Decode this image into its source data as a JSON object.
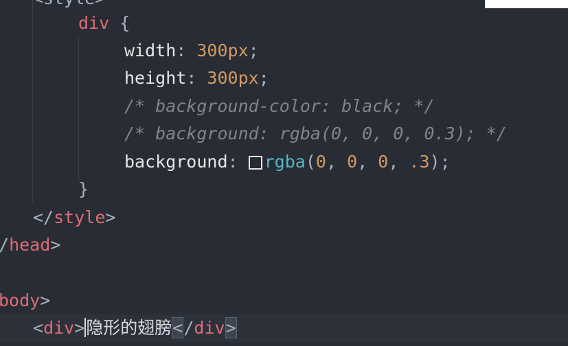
{
  "code": {
    "style_open": "<style>",
    "selector": "div",
    "open_brace": "{",
    "width_prop": "width",
    "width_val": "300px",
    "height_prop": "height",
    "height_val": "300px",
    "comment1": "/* background-color: black; */",
    "comment2": "/* background: rgba(0, 0, 0, 0.3); */",
    "bg_prop": "background",
    "bg_fn": "rgba",
    "bg_r": "0",
    "bg_g": "0",
    "bg_b": "0",
    "bg_a": ".3",
    "close_brace": "}",
    "style_close_tag": "style",
    "head_close_tag": "head",
    "body_tag": "body",
    "div_tag": "div",
    "div_text": "隐形的翅膀"
  },
  "colors": {
    "tag": "#e06c75",
    "number": "#d19a66",
    "function": "#56b6c2",
    "comment": "#7f848e",
    "background": "#282c34"
  },
  "icons": {
    "color_swatch": "color-swatch-icon"
  }
}
